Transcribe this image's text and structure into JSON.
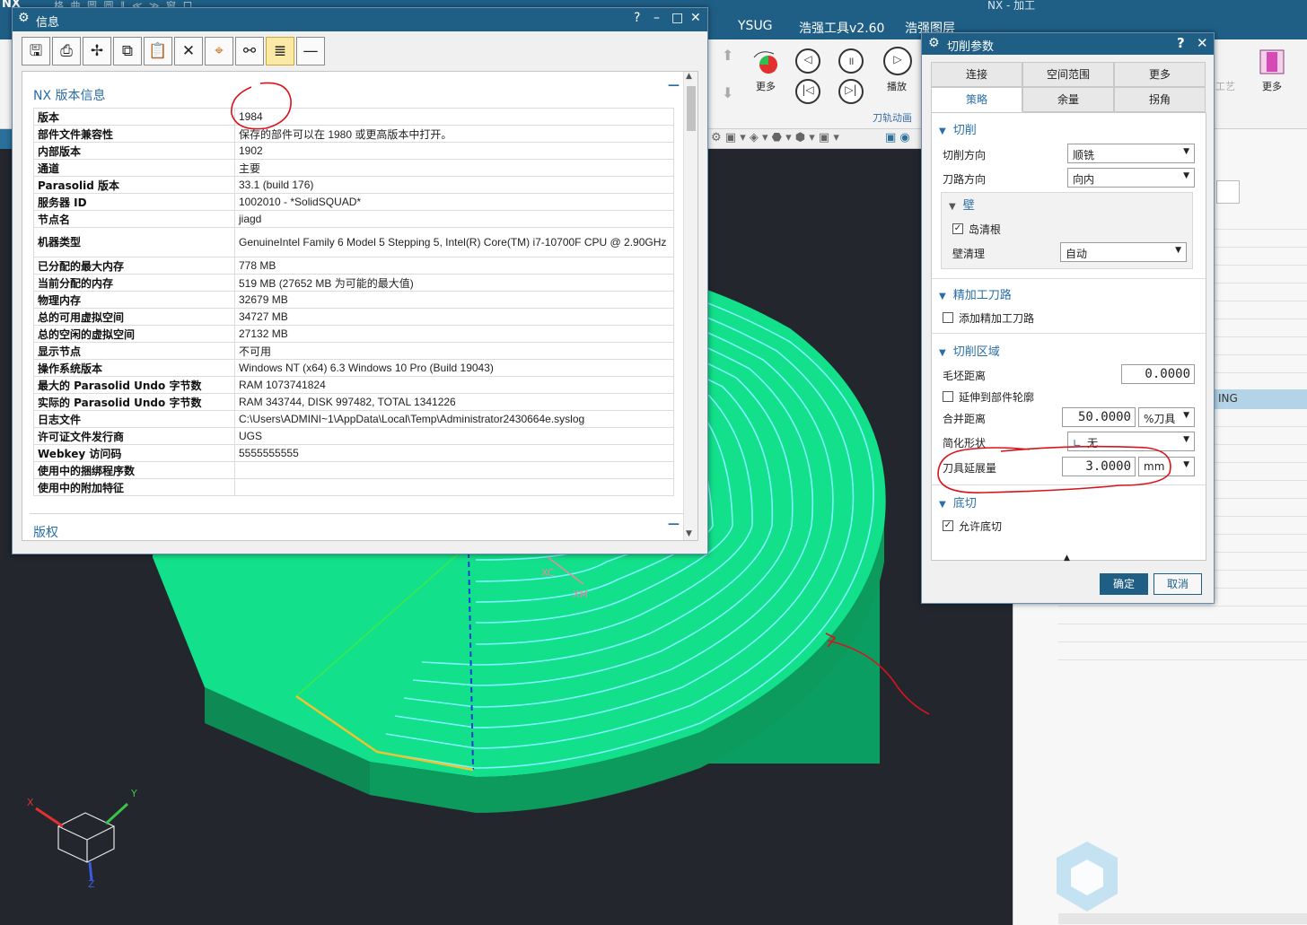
{
  "app": {
    "logo": "NX",
    "title": "NX - 加工",
    "ghost_toolbar": "格 曲 圆 圆 ∥ ≪ ≫ 窗 口"
  },
  "menubar": {
    "items": [
      "YSUG",
      "浩强工具v2.60",
      "浩强图层"
    ]
  },
  "ribbon": {
    "more_label": "更多",
    "play_label": "播放",
    "group_label": "刀轨动画",
    "right_more": "更多",
    "right_partial": "工艺"
  },
  "right_panel": {
    "selected_text": "ING"
  },
  "info": {
    "title": "信息",
    "controls": [
      "?",
      "–",
      "□",
      "✕"
    ],
    "tools": [
      "save-icon",
      "print-icon",
      "fan-icon",
      "copy-icon",
      "paste-icon",
      "close-icon",
      "crosshair-icon",
      "binoculars-icon",
      "wrap-icon",
      "minus-icon"
    ],
    "section_title": "NX 版本信息",
    "copyright_title": "版权",
    "rows": [
      {
        "k": "版本",
        "v": "1984"
      },
      {
        "k": "部件文件兼容性",
        "v": "保存的部件可以在 1980 或更高版本中打开。"
      },
      {
        "k": "内部版本",
        "v": "1902"
      },
      {
        "k": "通道",
        "v": "主要"
      },
      {
        "k": "Parasolid 版本",
        "v": "33.1 (build 176)"
      },
      {
        "k": "服务器 ID",
        "v": "1002010 - *SolidSQUAD*"
      },
      {
        "k": "节点名",
        "v": "jiagd"
      },
      {
        "k": "机器类型",
        "v": "GenuineIntel Family 6 Model 5 Stepping 5, Intel(R) Core(TM) i7-10700F CPU @ 2.90GHz"
      },
      {
        "k": "已分配的最大内存",
        "v": "778 MB"
      },
      {
        "k": "当前分配的内存",
        "v": "519 MB (27652 MB 为可能的最大值)"
      },
      {
        "k": "物理内存",
        "v": "32679 MB"
      },
      {
        "k": "总的可用虚拟空间",
        "v": "34727 MB"
      },
      {
        "k": "总的空闲的虚拟空间",
        "v": "27132 MB"
      },
      {
        "k": "显示节点",
        "v": "不可用"
      },
      {
        "k": "操作系统版本",
        "v": "Windows NT (x64) 6.3 Windows 10 Pro (Build 19043)"
      },
      {
        "k": "最大的 Parasolid Undo 字节数",
        "v": "RAM 1073741824"
      },
      {
        "k": "实际的 Parasolid Undo 字节数",
        "v": "RAM 343744, DISK 997482, TOTAL 1341226"
      },
      {
        "k": "日志文件",
        "v": "C:\\Users\\ADMINI~1\\AppData\\Local\\Temp\\Administrator2430664e.syslog"
      },
      {
        "k": "许可证文件发行商",
        "v": "UGS"
      },
      {
        "k": "Webkey 访问码",
        "v": "5555555555"
      },
      {
        "k": "使用中的捆绑程序数",
        "v": ""
      },
      {
        "k": "使用中的附加特征",
        "v": ""
      }
    ]
  },
  "cut": {
    "title": "切削参数",
    "help": "?",
    "close": "✕",
    "tabs_row1": [
      "连接",
      "空间范围",
      "更多"
    ],
    "tabs_row2": [
      "策略",
      "余量",
      "拐角"
    ],
    "groups": {
      "cut": "切削",
      "finish": "精加工刀路",
      "region": "切削区域",
      "undercut": "底切"
    },
    "fields": {
      "cut_direction_label": "切削方向",
      "cut_direction_value": "顺铣",
      "path_direction_label": "刀路方向",
      "path_direction_value": "向内",
      "wall_label": "壁",
      "island_clean_label": "岛清根",
      "wall_clean_label": "壁清理",
      "wall_clean_value": "自动",
      "add_finish_label": "添加精加工刀路",
      "blank_distance_label": "毛坯距离",
      "blank_distance_value": "0.0000",
      "extend_to_part_label": "延伸到部件轮廓",
      "merge_distance_label": "合并距离",
      "merge_distance_value": "50.0000",
      "merge_distance_unit": "%刀具",
      "simplify_label": "简化形状",
      "simplify_value": "无",
      "tool_extension_label": "刀具延展量",
      "tool_extension_value": "3.0000",
      "tool_extension_unit": "mm",
      "allow_undercut_label": "允许底切"
    },
    "checks": {
      "island_clean": true,
      "add_finish": false,
      "extend_to_part": false,
      "allow_undercut": true
    },
    "ok": "确定",
    "cancel": "取消"
  },
  "viewport": {
    "labels": {
      "xc": "XC",
      "xm": "XM",
      "x": "X",
      "y": "Y",
      "z": "Z"
    }
  },
  "colors": {
    "title_bar": "#1f5f86",
    "part_green": "#12e08a",
    "toolpath": "#7ff5ff",
    "annotation": "#d8141c"
  }
}
